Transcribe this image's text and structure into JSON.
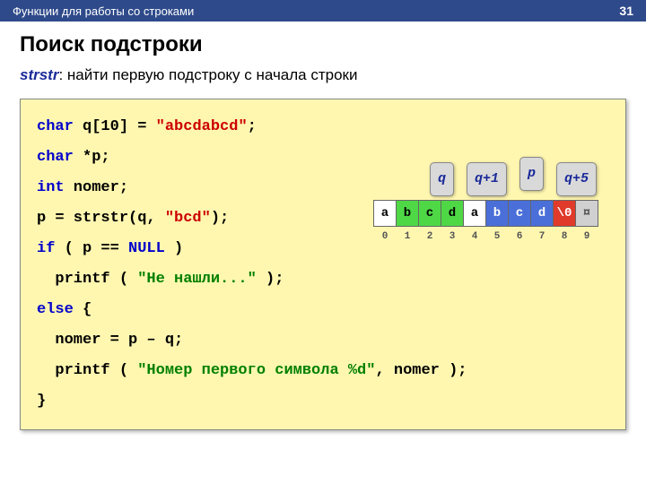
{
  "header": {
    "section": "Функции для работы со строками",
    "page": "31"
  },
  "title": "Поиск подстроки",
  "subtitle": {
    "keyword": "strstr",
    "rest": ": найти первую подстроку с начала строки"
  },
  "tags": {
    "q": "q",
    "q1": "q+1",
    "p": "p",
    "q5": "q+5"
  },
  "mem": {
    "cells": [
      "a",
      "b",
      "c",
      "d",
      "a",
      "b",
      "c",
      "d",
      "\\0",
      "¤"
    ],
    "idx": [
      "0",
      "1",
      "2",
      "3",
      "4",
      "5",
      "6",
      "7",
      "8",
      "9"
    ]
  },
  "code": {
    "char": "char",
    "int": "int",
    "if": "if",
    "else": "else",
    "nullkw": "NULL",
    "decl_arr": " q[10] = ",
    "lit1": "\"abcdabcd\"",
    "semi": ";",
    "decl_ptr": " *p;",
    "decl_nomer": " nomer;",
    "assign_p": "p = strstr(q, ",
    "lit2": "\"bcd\"",
    "close_call": ");",
    "if_cond": " ( p == ",
    "if_close": " )",
    "printf1a": "  printf ( ",
    "lit3": "\"Не нашли...\"",
    "printf1b": " );",
    "else_brace": " {",
    "nomer_line": "  nomer = p – q;",
    "printf2a": "  printf ( ",
    "lit4": "\"Номер первого символа %d\"",
    "printf2b": ", nomer );",
    "close_brace": "}"
  }
}
